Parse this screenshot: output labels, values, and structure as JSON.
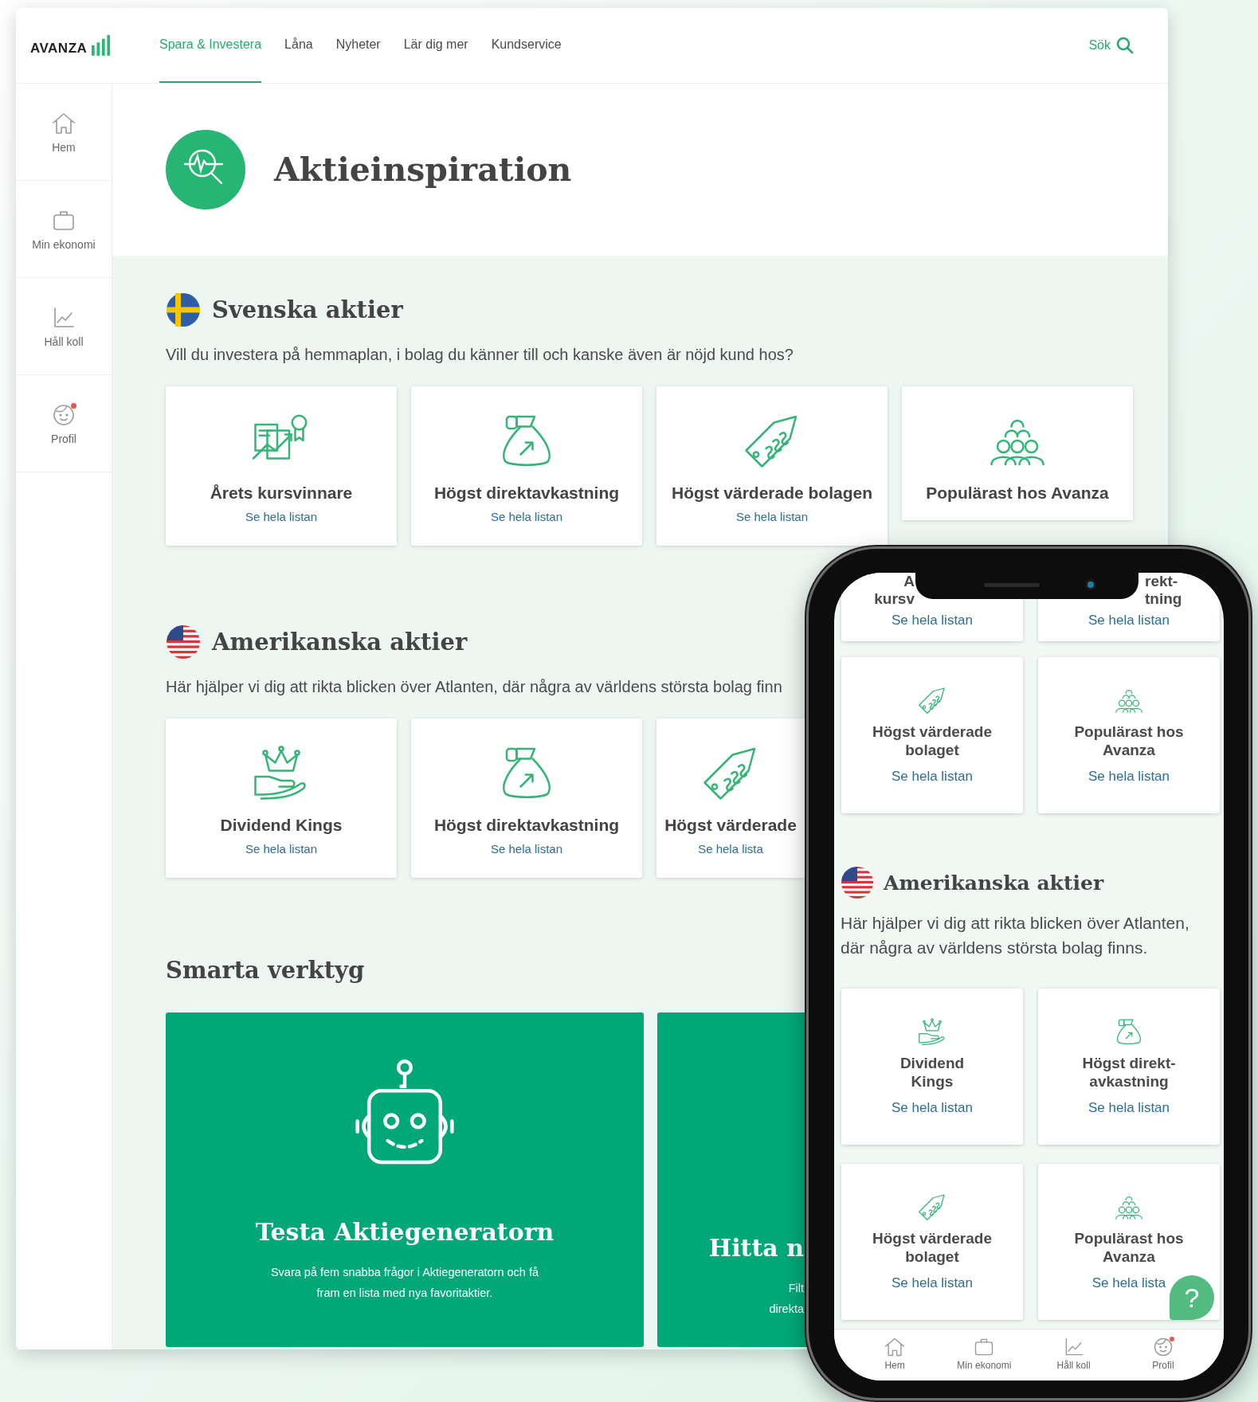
{
  "desktop": {
    "logo": "AVANZA",
    "nav": [
      {
        "label": "Spara & Investera",
        "selected": true
      },
      {
        "label": "Låna",
        "selected": false
      },
      {
        "label": "Nyheter",
        "selected": false
      },
      {
        "label": "Lär dig mer",
        "selected": false
      },
      {
        "label": "Kundservice",
        "selected": false
      }
    ],
    "search": "Sök",
    "sidebar": [
      {
        "kind": "home",
        "label": "Hem",
        "notification": false
      },
      {
        "kind": "wallet",
        "label": "Min ekonomi",
        "notification": false
      },
      {
        "kind": "chart",
        "label": "Håll koll",
        "notification": false
      },
      {
        "kind": "profile",
        "label": "Profil",
        "notification": true
      }
    ],
    "page_title": "Aktieinspiration",
    "sections": [
      {
        "kind": "se",
        "title": "Svenska aktier",
        "description": "Vill du investera på hemmaplan, i bolag du känner till och kanske även är nöjd kund hos?",
        "cards": [
          {
            "kind": "winner",
            "title": "Årets kursvinnare",
            "link": "Se hela listan",
            "covered": false
          },
          {
            "kind": "bag",
            "title": "Högst direktavkastning",
            "link": "Se hela listan",
            "covered": false
          },
          {
            "kind": "tag",
            "title": "Högst värderade bolagen",
            "link": "Se hela listan",
            "covered": false
          },
          {
            "kind": "group",
            "title": "Populärast hos Avanza",
            "covered": true
          }
        ]
      },
      {
        "kind": "us",
        "title": "Amerikanska aktier",
        "description": "Här hjälper vi dig att rikta blicken över Atlanten, där några av världens största bolag finn",
        "cards": [
          {
            "kind": "crown",
            "title": "Dividend Kings",
            "link": "Se hela listan",
            "covered": false
          },
          {
            "kind": "bag",
            "title": "Högst direktavkastning",
            "link": "Se hela listan",
            "covered": false
          },
          {
            "kind": "tag",
            "title": "Högst värderade",
            "link": "Se hela lista",
            "covered": true
          }
        ]
      }
    ],
    "tools_title": "Smarta verktyg",
    "tools": [
      {
        "kind": "robot",
        "title": "Testa Aktiegeneratorn",
        "description_lines": [
          "Svara på fem snabba frågor i Aktiegeneratorn och få",
          "fram en lista med nya favoritaktier."
        ],
        "covered": false
      },
      {
        "title": "Hitta n",
        "description_lines": [
          "Filt",
          "direkta"
        ],
        "covered": true
      }
    ]
  },
  "phone": {
    "top_cards": [
      {
        "title_lines": [
          "A",
          "kursv"
        ],
        "link": "Se hela listan"
      },
      {
        "title_lines": [
          "rekt-",
          "tning"
        ],
        "link": "Se hela listan"
      }
    ],
    "cards": [
      {
        "kind": "tag",
        "title_lines": [
          "Högst värderade",
          "bolaget"
        ],
        "link": "Se hela listan"
      },
      {
        "kind": "group",
        "title_lines": [
          "Populärast hos",
          "Avanza"
        ],
        "link": "Se hela listan"
      }
    ],
    "section": {
      "kind": "us",
      "title": "Amerikanska aktier",
      "description_lines": [
        "Här hjälper vi dig att rikta blicken över Atlanten,",
        "där några av världens största bolag finns."
      ],
      "cards": [
        {
          "kind": "crown",
          "title_lines": [
            "Dividend",
            "Kings"
          ],
          "link": "Se hela listan"
        },
        {
          "kind": "bag",
          "title_lines": [
            "Högst direkt-",
            "avkastning"
          ],
          "link": "Se hela listan"
        },
        {
          "kind": "tag",
          "title_lines": [
            "Högst värderade",
            "bolaget"
          ],
          "link": "Se hela listan"
        },
        {
          "kind": "group",
          "title_lines": [
            "Populärast hos",
            "Avanza"
          ],
          "link": "Se hela lista"
        }
      ]
    },
    "help": "?",
    "nav": [
      {
        "kind": "home",
        "label": "Hem",
        "notification": false
      },
      {
        "kind": "wallet",
        "label": "Min ekonomi",
        "notification": false
      },
      {
        "kind": "chart",
        "label": "Håll koll",
        "notification": false
      },
      {
        "kind": "profile",
        "label": "Profil",
        "notification": true
      }
    ]
  }
}
